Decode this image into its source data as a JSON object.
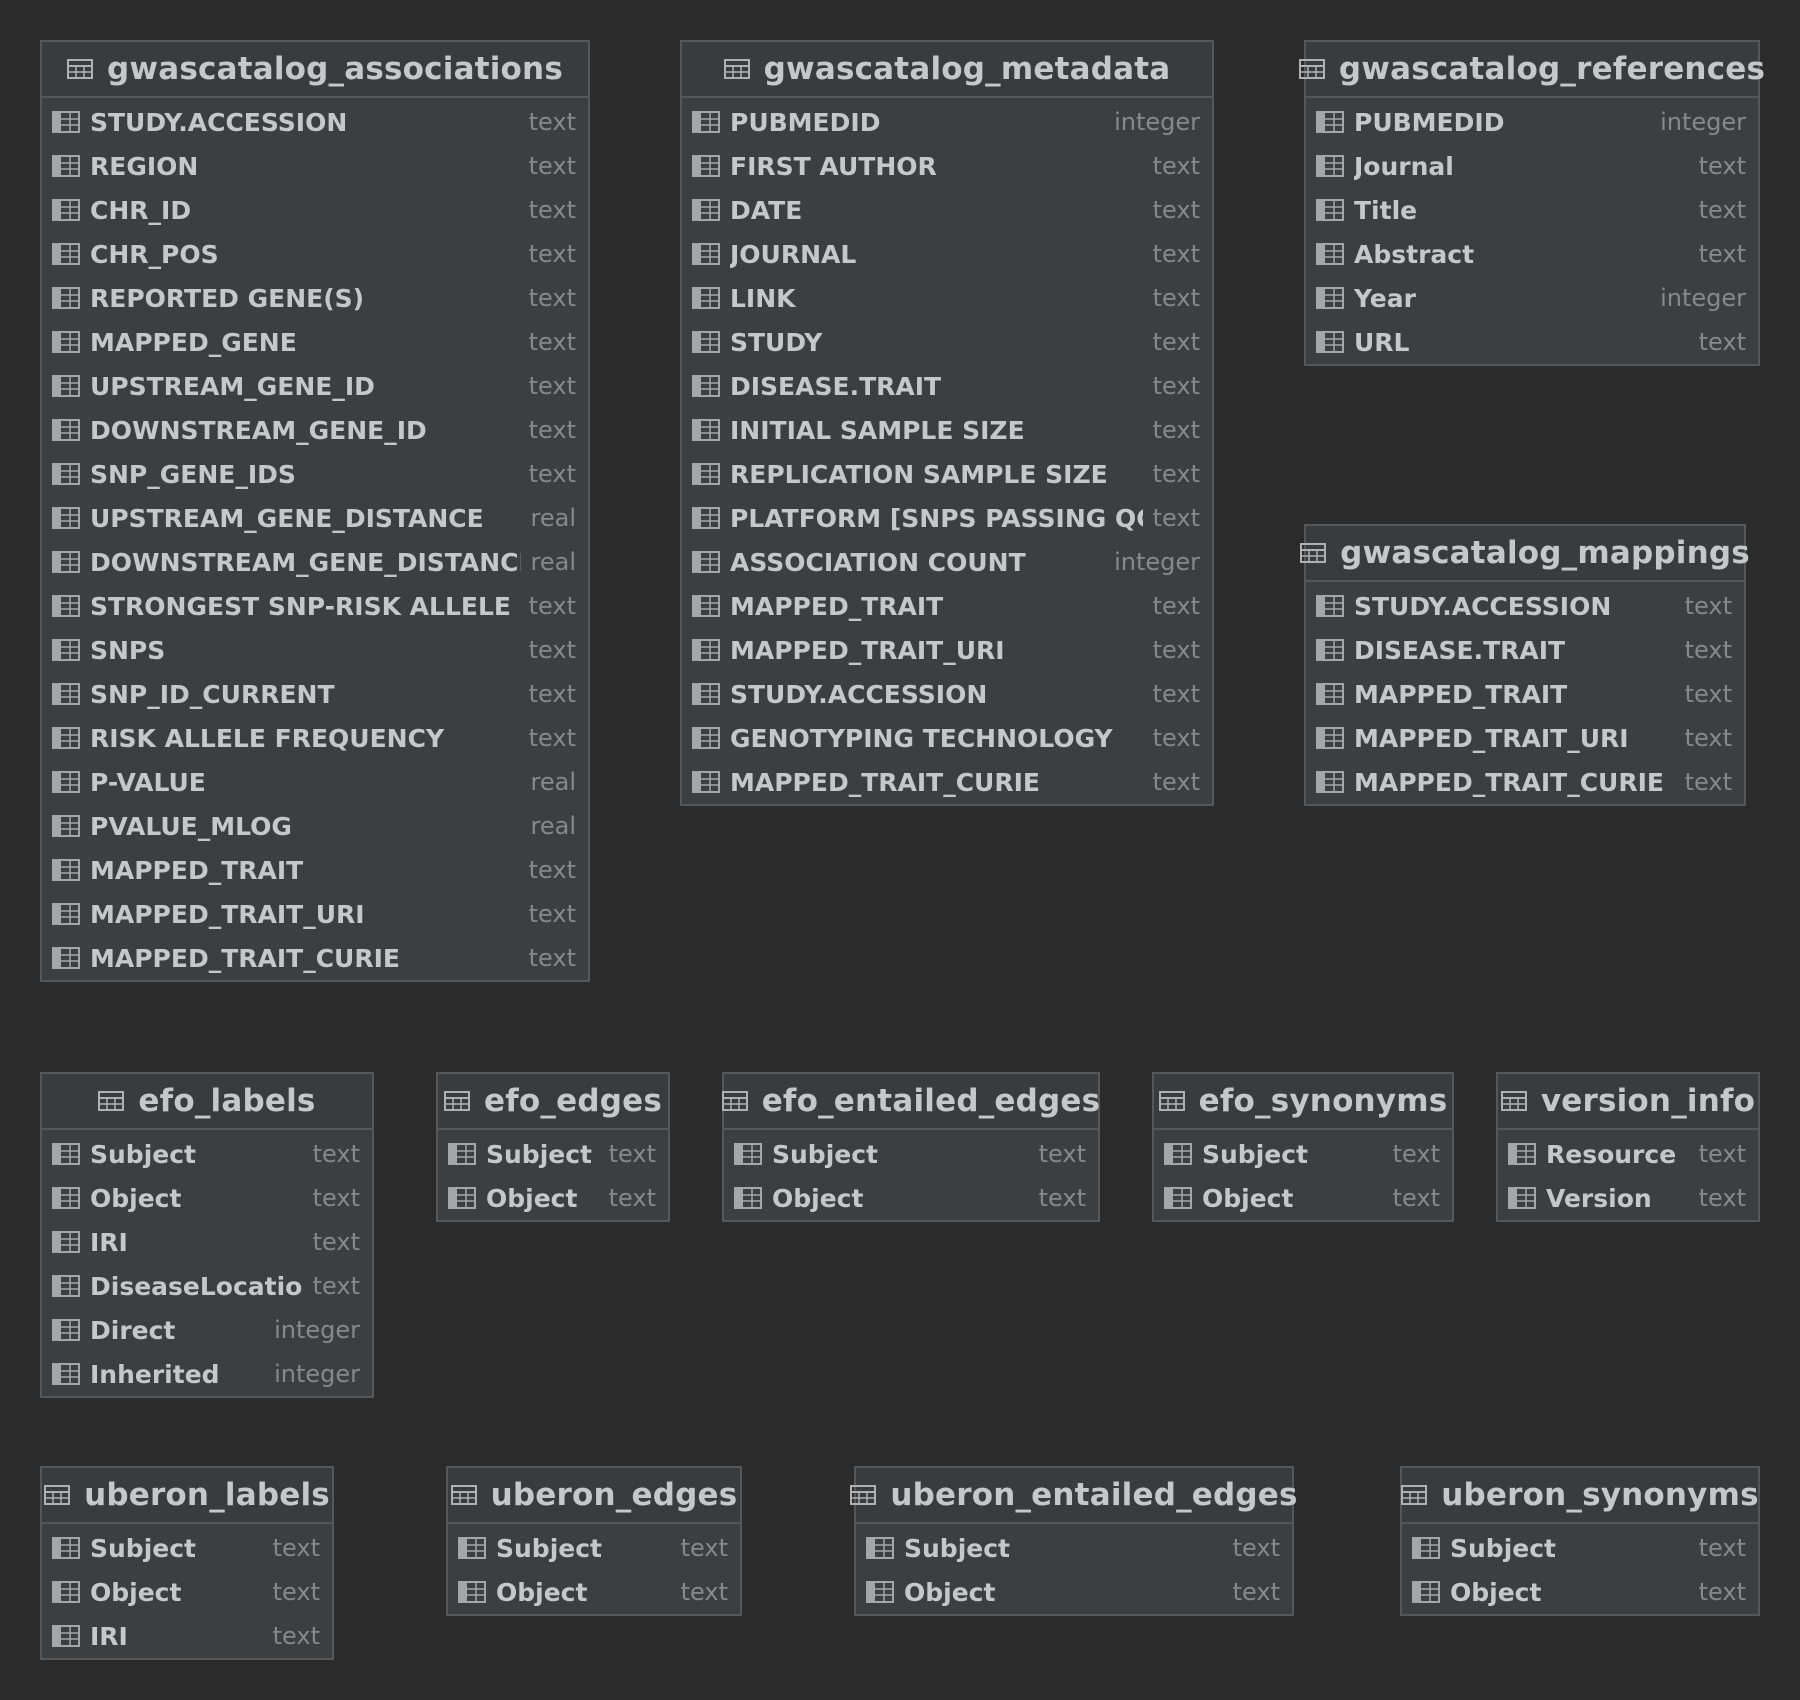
{
  "tables": [
    {
      "name": "gwascatalog_associations",
      "columns": [
        {
          "name": "STUDY.ACCESSION",
          "type": "text"
        },
        {
          "name": "REGION",
          "type": "text"
        },
        {
          "name": "CHR_ID",
          "type": "text"
        },
        {
          "name": "CHR_POS",
          "type": "text"
        },
        {
          "name": "REPORTED GENE(S)",
          "type": "text"
        },
        {
          "name": "MAPPED_GENE",
          "type": "text"
        },
        {
          "name": "UPSTREAM_GENE_ID",
          "type": "text"
        },
        {
          "name": "DOWNSTREAM_GENE_ID",
          "type": "text"
        },
        {
          "name": "SNP_GENE_IDS",
          "type": "text"
        },
        {
          "name": "UPSTREAM_GENE_DISTANCE",
          "type": "real"
        },
        {
          "name": "DOWNSTREAM_GENE_DISTANCE",
          "type": "real"
        },
        {
          "name": "STRONGEST SNP-RISK ALLELE",
          "type": "text"
        },
        {
          "name": "SNPS",
          "type": "text"
        },
        {
          "name": "SNP_ID_CURRENT",
          "type": "text"
        },
        {
          "name": "RISK ALLELE FREQUENCY",
          "type": "text"
        },
        {
          "name": "P-VALUE",
          "type": "real"
        },
        {
          "name": "PVALUE_MLOG",
          "type": "real"
        },
        {
          "name": "MAPPED_TRAIT",
          "type": "text"
        },
        {
          "name": "MAPPED_TRAIT_URI",
          "type": "text"
        },
        {
          "name": "MAPPED_TRAIT_CURIE",
          "type": "text"
        }
      ]
    },
    {
      "name": "gwascatalog_metadata",
      "columns": [
        {
          "name": "PUBMEDID",
          "type": "integer"
        },
        {
          "name": "FIRST AUTHOR",
          "type": "text"
        },
        {
          "name": "DATE",
          "type": "text"
        },
        {
          "name": "JOURNAL",
          "type": "text"
        },
        {
          "name": "LINK",
          "type": "text"
        },
        {
          "name": "STUDY",
          "type": "text"
        },
        {
          "name": "DISEASE.TRAIT",
          "type": "text"
        },
        {
          "name": "INITIAL SAMPLE SIZE",
          "type": "text"
        },
        {
          "name": "REPLICATION SAMPLE SIZE",
          "type": "text"
        },
        {
          "name": "PLATFORM [SNPS PASSING QC]",
          "type": "text"
        },
        {
          "name": "ASSOCIATION COUNT",
          "type": "integer"
        },
        {
          "name": "MAPPED_TRAIT",
          "type": "text"
        },
        {
          "name": "MAPPED_TRAIT_URI",
          "type": "text"
        },
        {
          "name": "STUDY.ACCESSION",
          "type": "text"
        },
        {
          "name": "GENOTYPING TECHNOLOGY",
          "type": "text"
        },
        {
          "name": "MAPPED_TRAIT_CURIE",
          "type": "text"
        }
      ]
    },
    {
      "name": "gwascatalog_references",
      "columns": [
        {
          "name": "PUBMEDID",
          "type": "integer"
        },
        {
          "name": "Journal",
          "type": "text"
        },
        {
          "name": "Title",
          "type": "text"
        },
        {
          "name": "Abstract",
          "type": "text"
        },
        {
          "name": "Year",
          "type": "integer"
        },
        {
          "name": "URL",
          "type": "text"
        }
      ]
    },
    {
      "name": "gwascatalog_mappings",
      "columns": [
        {
          "name": "STUDY.ACCESSION",
          "type": "text"
        },
        {
          "name": "DISEASE.TRAIT",
          "type": "text"
        },
        {
          "name": "MAPPED_TRAIT",
          "type": "text"
        },
        {
          "name": "MAPPED_TRAIT_URI",
          "type": "text"
        },
        {
          "name": "MAPPED_TRAIT_CURIE",
          "type": "text"
        }
      ]
    },
    {
      "name": "efo_labels",
      "columns": [
        {
          "name": "Subject",
          "type": "text"
        },
        {
          "name": "Object",
          "type": "text"
        },
        {
          "name": "IRI",
          "type": "text"
        },
        {
          "name": "DiseaseLocation",
          "type": "text"
        },
        {
          "name": "Direct",
          "type": "integer"
        },
        {
          "name": "Inherited",
          "type": "integer"
        }
      ]
    },
    {
      "name": "efo_edges",
      "columns": [
        {
          "name": "Subject",
          "type": "text"
        },
        {
          "name": "Object",
          "type": "text"
        }
      ]
    },
    {
      "name": "efo_entailed_edges",
      "columns": [
        {
          "name": "Subject",
          "type": "text"
        },
        {
          "name": "Object",
          "type": "text"
        }
      ]
    },
    {
      "name": "efo_synonyms",
      "columns": [
        {
          "name": "Subject",
          "type": "text"
        },
        {
          "name": "Object",
          "type": "text"
        }
      ]
    },
    {
      "name": "version_info",
      "columns": [
        {
          "name": "Resource",
          "type": "text"
        },
        {
          "name": "Version",
          "type": "text"
        }
      ]
    },
    {
      "name": "uberon_labels",
      "columns": [
        {
          "name": "Subject",
          "type": "text"
        },
        {
          "name": "Object",
          "type": "text"
        },
        {
          "name": "IRI",
          "type": "text"
        }
      ]
    },
    {
      "name": "uberon_edges",
      "columns": [
        {
          "name": "Subject",
          "type": "text"
        },
        {
          "name": "Object",
          "type": "text"
        }
      ]
    },
    {
      "name": "uberon_entailed_edges",
      "columns": [
        {
          "name": "Subject",
          "type": "text"
        },
        {
          "name": "Object",
          "type": "text"
        }
      ]
    },
    {
      "name": "uberon_synonyms",
      "columns": [
        {
          "name": "Subject",
          "type": "text"
        },
        {
          "name": "Object",
          "type": "text"
        }
      ]
    }
  ]
}
